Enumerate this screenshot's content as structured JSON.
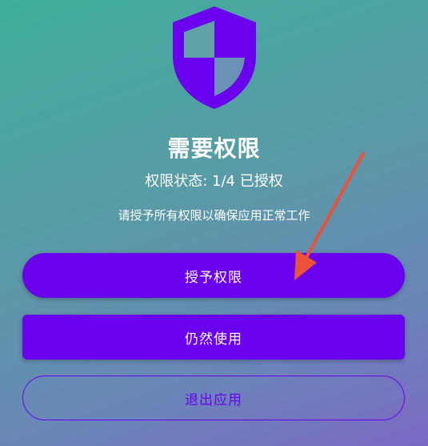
{
  "header": {
    "icon": "shield-icon",
    "title": "需要权限",
    "status": "权限状态: 1/4 已授权",
    "description": "请授予所有权限以确保应用正常工作"
  },
  "actions": {
    "grant_label": "授予权限",
    "continue_label": "仍然使用",
    "exit_label": "退出应用"
  },
  "annotation": {
    "icon": "red-arrow-icon"
  },
  "colors": {
    "accent": "#6a00ee",
    "text": "#ffffff",
    "arrow": "#e8533a"
  }
}
